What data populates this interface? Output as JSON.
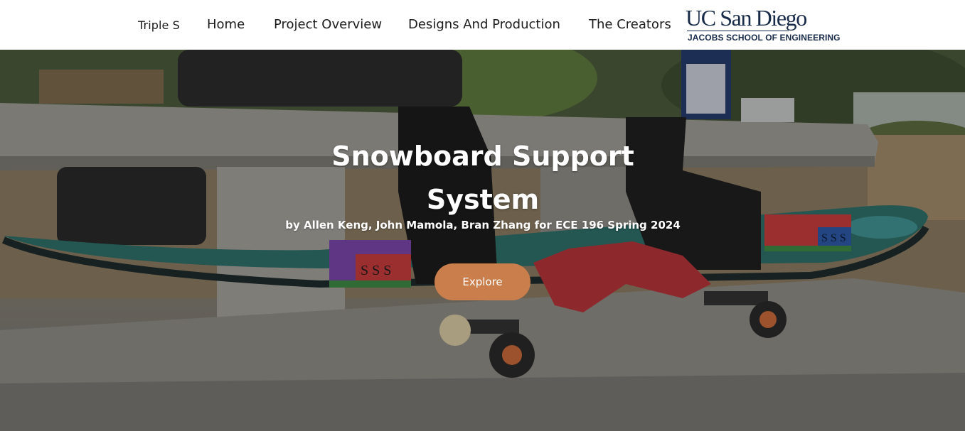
{
  "header": {
    "brand": "Triple S",
    "nav": [
      {
        "label": "Home"
      },
      {
        "label": "Project Overview"
      },
      {
        "label": "Designs And Production"
      },
      {
        "label": "The Creators"
      }
    ],
    "logo": {
      "main": "UC San Diego",
      "sub": "JACOBS SCHOOL OF ENGINEERING",
      "color": "#182b49"
    }
  },
  "hero": {
    "title": "Snowboard Support System",
    "subtitle": "by Allen Keng, John Mamola, Bran Zhang for ECE 196 Spring 2024",
    "button_label": "Explore",
    "button_color": "#c97e4c",
    "box_label": "S S S"
  }
}
